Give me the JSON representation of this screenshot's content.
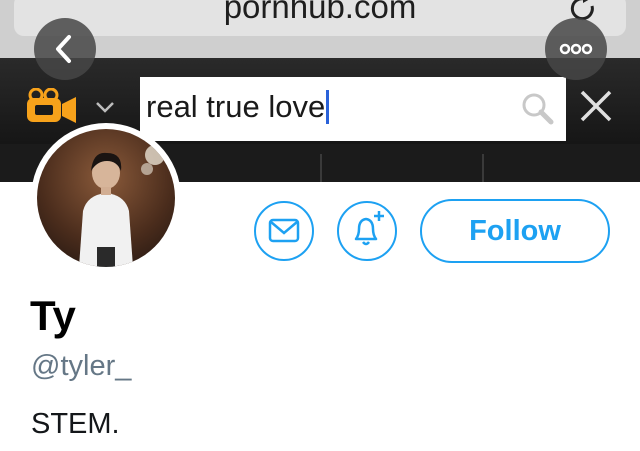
{
  "browser": {
    "url": "pornhub.com",
    "search_query": "real true love"
  },
  "icons": {
    "back": "chevron-left-icon",
    "more": "more-dots-icon",
    "reload": "reload-icon",
    "camera": "video-camera-icon",
    "dropdown": "chevron-down-icon",
    "search": "magnifier-icon",
    "close": "close-icon",
    "mail": "mail-icon",
    "notify": "bell-plus-icon"
  },
  "colors": {
    "accent": "#1da1f2",
    "camera": "#f7a21b",
    "handle": "#657786"
  },
  "profile": {
    "display_name": "Ty",
    "handle": "@tyler_",
    "bio": "STEM.",
    "follow_label": "Follow"
  }
}
